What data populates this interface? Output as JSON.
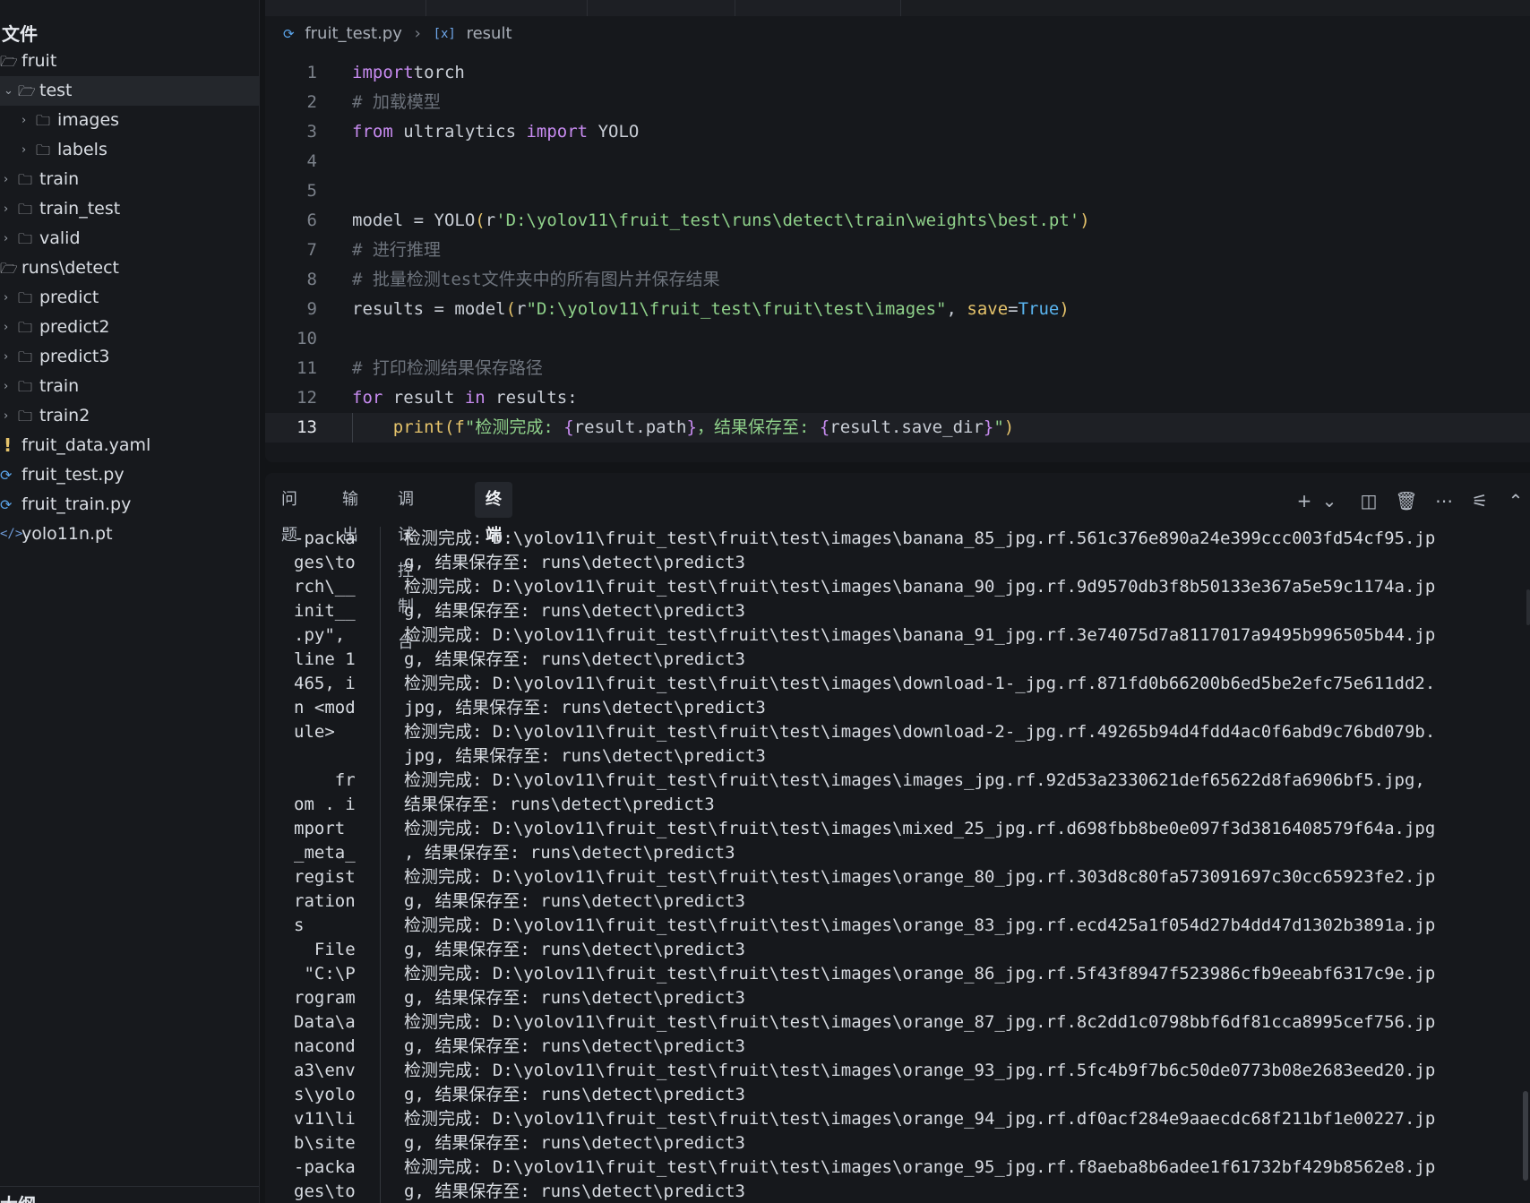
{
  "explorer": {
    "title": "文件",
    "items": [
      {
        "label": "fruit",
        "icon": "folder-open-icon",
        "level": 0,
        "expanded": true
      },
      {
        "label": "test",
        "icon": "folder-open-icon",
        "level": 1,
        "expanded": true,
        "selected": true
      },
      {
        "label": "images",
        "icon": "folder-icon",
        "level": 2,
        "expanded": false
      },
      {
        "label": "labels",
        "icon": "folder-icon",
        "level": 2,
        "expanded": false
      },
      {
        "label": "train",
        "icon": "folder-icon",
        "level": 1,
        "expanded": false
      },
      {
        "label": "train_test",
        "icon": "folder-icon",
        "level": 1,
        "expanded": false
      },
      {
        "label": "valid",
        "icon": "folder-icon",
        "level": 1,
        "expanded": false
      },
      {
        "label": "runs\\detect",
        "icon": "folder-open-icon",
        "level": 0,
        "expanded": true
      },
      {
        "label": "predict",
        "icon": "folder-icon",
        "level": 1,
        "expanded": false
      },
      {
        "label": "predict2",
        "icon": "folder-icon",
        "level": 1,
        "expanded": false
      },
      {
        "label": "predict3",
        "icon": "folder-icon",
        "level": 1,
        "expanded": false
      },
      {
        "label": "train",
        "icon": "folder-icon",
        "level": 1,
        "expanded": false
      },
      {
        "label": "train2",
        "icon": "folder-icon",
        "level": 1,
        "expanded": false
      },
      {
        "label": "fruit_data.yaml",
        "icon": "yaml-file-icon",
        "level": 0
      },
      {
        "label": "fruit_test.py",
        "icon": "python-file-icon",
        "level": 0
      },
      {
        "label": "fruit_train.py",
        "icon": "python-file-icon",
        "level": 0
      },
      {
        "label": "yolo11n.pt",
        "icon": "binary-file-icon",
        "level": 0
      }
    ],
    "outline_title": "大纲"
  },
  "editor": {
    "breadcrumb": {
      "file": "fruit_test.py",
      "symbol": "result"
    },
    "current_line": 13,
    "lines": [
      {
        "n": "1",
        "tokens": [
          [
            "kw",
            "import"
          ],
          [
            "",
            "torch"
          ]
        ]
      },
      {
        "n": "2",
        "tokens": [
          [
            "cm",
            "# 加载模型"
          ]
        ]
      },
      {
        "n": "3",
        "tokens": [
          [
            "kw",
            "from"
          ],
          [
            "",
            " ultralytics "
          ],
          [
            "kw",
            "import"
          ],
          [
            "",
            " YOLO"
          ]
        ]
      },
      {
        "n": "4",
        "tokens": []
      },
      {
        "n": "5",
        "tokens": []
      },
      {
        "n": "6",
        "tokens": [
          [
            "",
            "model = YOLO"
          ],
          [
            "par",
            "("
          ],
          [
            "",
            "r"
          ],
          [
            "str",
            "'D:\\yolov11\\fruit_test\\runs\\detect\\train\\weights\\best.pt'"
          ],
          [
            "par",
            ")"
          ]
        ]
      },
      {
        "n": "7",
        "tokens": [
          [
            "cm",
            "# 进行推理"
          ]
        ]
      },
      {
        "n": "8",
        "tokens": [
          [
            "cm",
            "# 批量检测test文件夹中的所有图片并保存结果"
          ]
        ]
      },
      {
        "n": "9",
        "tokens": [
          [
            "",
            "results = model"
          ],
          [
            "par",
            "("
          ],
          [
            "",
            "r"
          ],
          [
            "str",
            "\"D:\\yolov11\\fruit_test\\fruit\\test\\images\""
          ],
          [
            "",
            ", "
          ],
          [
            "fn",
            "save"
          ],
          [
            "",
            "="
          ],
          [
            "bool",
            "True"
          ],
          [
            "par",
            ")"
          ]
        ]
      },
      {
        "n": "10",
        "tokens": []
      },
      {
        "n": "11",
        "tokens": [
          [
            "cm",
            "# 打印检测结果保存路径"
          ]
        ]
      },
      {
        "n": "12",
        "tokens": [
          [
            "kw",
            "for"
          ],
          [
            "",
            " result "
          ],
          [
            "kw",
            "in"
          ],
          [
            "",
            " results:"
          ]
        ]
      },
      {
        "n": "13",
        "tokens": [
          [
            "",
            "    "
          ],
          [
            "fn",
            "print"
          ],
          [
            "par",
            "("
          ],
          [
            "fn",
            "f"
          ],
          [
            "str",
            "\"检测完成: "
          ],
          [
            "brace",
            "{"
          ],
          [
            "",
            "result.path"
          ],
          [
            "brace",
            "}"
          ],
          [
            "str",
            "，结果保存至: "
          ],
          [
            "brace",
            "{"
          ],
          [
            "",
            "result.save_dir"
          ],
          [
            "brace",
            "}"
          ],
          [
            "str",
            "\""
          ],
          [
            "par",
            ")"
          ]
        ]
      }
    ]
  },
  "panel": {
    "tabs": [
      {
        "label": "问题",
        "active": false
      },
      {
        "label": "输出",
        "active": false
      },
      {
        "label": "调试控制台",
        "active": false
      },
      {
        "label": "终端",
        "active": true
      }
    ],
    "actions": [
      "plus-icon",
      "chevron-down-icon",
      "split-icon",
      "trash-icon",
      "more-icon",
      "settings-sliders-icon",
      "chevron-up-icon"
    ],
    "terminal_left": [
      "-packa",
      "ges\\to",
      "rch\\__",
      "init__",
      ".py\",",
      "line 1",
      "465, i",
      "n <mod",
      "ule>",
      "",
      "    fr",
      "om . i",
      "mport",
      "_meta_",
      "regist",
      "ration",
      "s",
      "  File",
      " \"C:\\P",
      "rogram",
      "Data\\a",
      "nacond",
      "a3\\env",
      "s\\yolo",
      "v11\\li",
      "b\\site",
      "-packa",
      "ges\\to"
    ],
    "terminal_right": [
      "检测完成: D:\\yolov11\\fruit_test\\fruit\\test\\images\\banana_85_jpg.rf.561c376e890a24e399ccc003fd54cf95.jp",
      "g, 结果保存至: runs\\detect\\predict3",
      "检测完成: D:\\yolov11\\fruit_test\\fruit\\test\\images\\banana_90_jpg.rf.9d9570db3f8b50133e367a5e59c1174a.jp",
      "g, 结果保存至: runs\\detect\\predict3",
      "检测完成: D:\\yolov11\\fruit_test\\fruit\\test\\images\\banana_91_jpg.rf.3e74075d7a8117017a9495b996505b44.jp",
      "g, 结果保存至: runs\\detect\\predict3",
      "检测完成: D:\\yolov11\\fruit_test\\fruit\\test\\images\\download-1-_jpg.rf.871fd0b66200b6ed5be2efc75e611dd2.",
      "jpg, 结果保存至: runs\\detect\\predict3",
      "检测完成: D:\\yolov11\\fruit_test\\fruit\\test\\images\\download-2-_jpg.rf.49265b94d4fdd4ac0f6abd9c76bd079b.",
      "jpg, 结果保存至: runs\\detect\\predict3",
      "检测完成: D:\\yolov11\\fruit_test\\fruit\\test\\images\\images_jpg.rf.92d53a2330621def65622d8fa6906bf5.jpg,",
      "结果保存至: runs\\detect\\predict3",
      "检测完成: D:\\yolov11\\fruit_test\\fruit\\test\\images\\mixed_25_jpg.rf.d698fbb8be0e097f3d3816408579f64a.jpg",
      ", 结果保存至: runs\\detect\\predict3",
      "检测完成: D:\\yolov11\\fruit_test\\fruit\\test\\images\\orange_80_jpg.rf.303d8c80fa573091697c30cc65923fe2.jp",
      "g, 结果保存至: runs\\detect\\predict3",
      "检测完成: D:\\yolov11\\fruit_test\\fruit\\test\\images\\orange_83_jpg.rf.ecd425a1f054d27b4dd47d1302b3891a.jp",
      "g, 结果保存至: runs\\detect\\predict3",
      "检测完成: D:\\yolov11\\fruit_test\\fruit\\test\\images\\orange_86_jpg.rf.5f43f8947f523986cfb9eeabf6317c9e.jp",
      "g, 结果保存至: runs\\detect\\predict3",
      "检测完成: D:\\yolov11\\fruit_test\\fruit\\test\\images\\orange_87_jpg.rf.8c2dd1c0798bbf6df81cca8995cef756.jp",
      "g, 结果保存至: runs\\detect\\predict3",
      "检测完成: D:\\yolov11\\fruit_test\\fruit\\test\\images\\orange_93_jpg.rf.5fc4b9f7b6c50de0773b08e2683eed20.jp",
      "g, 结果保存至: runs\\detect\\predict3",
      "检测完成: D:\\yolov11\\fruit_test\\fruit\\test\\images\\orange_94_jpg.rf.df0acf284e9aaecdc68f211bf1e00227.jp",
      "g, 结果保存至: runs\\detect\\predict3",
      "检测完成: D:\\yolov11\\fruit_test\\fruit\\test\\images\\orange_95_jpg.rf.f8aeba8b6adee1f61732bf429b8562e8.jp",
      "g, 结果保存至: runs\\detect\\predict3"
    ]
  }
}
